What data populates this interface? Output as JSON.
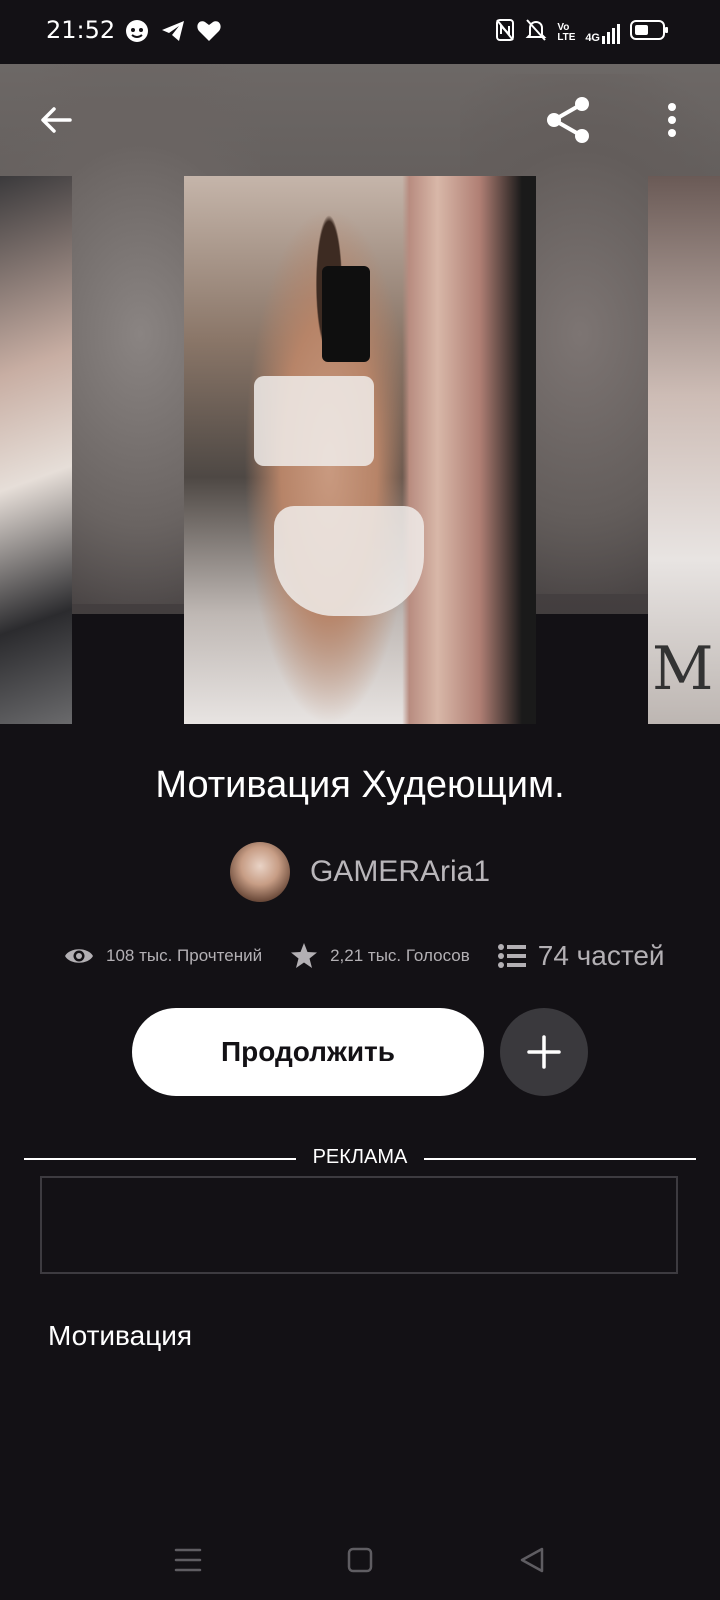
{
  "status_bar": {
    "time": "21:52",
    "left_icons": [
      "chat-bubble-icon",
      "telegram-icon",
      "heart-icon"
    ],
    "right_icons": [
      "nfc-icon",
      "bell-off-icon",
      "volte-icon",
      "signal-4g-icon",
      "battery-icon"
    ],
    "network_label": "4G",
    "volte_label": "Vo LTE"
  },
  "toolbar": {
    "back_icon": "arrow-left-icon",
    "share_icon": "share-icon",
    "more_icon": "more-vertical-icon"
  },
  "cover": {
    "right_peek_text": "M"
  },
  "story": {
    "title": "Мотивация Худеющим.",
    "author": "GAMERAria1",
    "stats": {
      "reads": "108 тыс. Прочтений",
      "votes": "2,21 тыс. Голосов",
      "parts": "74 частей"
    },
    "continue_label": "Продолжить",
    "tag": "Мотивация"
  },
  "ad": {
    "label": "РЕКЛАМА"
  },
  "nav": {
    "icons": [
      "menu-icon",
      "home-square-icon",
      "back-triangle-icon"
    ]
  },
  "colors": {
    "background": "#131115",
    "button_bg": "#ffffff",
    "add_button_bg": "#3a393d",
    "muted_text": "#b3b0b4"
  }
}
